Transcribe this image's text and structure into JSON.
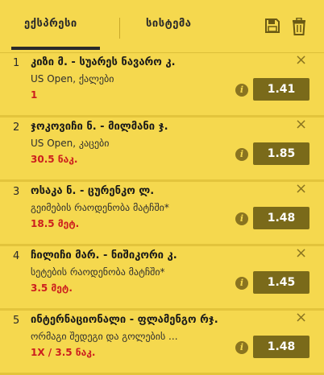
{
  "tabs": {
    "express": "ექსპრესი",
    "system": "სისტემა"
  },
  "icons": {
    "save": "save-icon",
    "trash": "trash-icon",
    "close": "close-icon",
    "info": "info-icon"
  },
  "colors": {
    "background": "#f5d84e",
    "odds_box": "#7a6a1a",
    "pick_red": "#cc1e1e"
  },
  "bets": [
    {
      "num": "1",
      "title": "კიზი მ. - სუარეს ნავარო კ.",
      "market": "US Open, ქალები",
      "pick": "1",
      "odds": "1.41",
      "close": "×",
      "info": "i"
    },
    {
      "num": "2",
      "title": "ჯოკოვიჩი ნ. - მილმანი ჯ.",
      "market": "US Open, კაცები",
      "pick": "30.5 ნაკ.",
      "odds": "1.85",
      "close": "×",
      "info": "i"
    },
    {
      "num": "3",
      "title": "ოსაკა ნ. - ცურენკო ლ.",
      "market": "გეიმების რაოდენობა მატჩში*",
      "pick": "18.5 მეტ.",
      "odds": "1.48",
      "close": "×",
      "info": "i"
    },
    {
      "num": "4",
      "title": "ჩილიჩი მარ. - ნიშიკორი კ.",
      "market": "სეტების რაოდენობა მატჩში*",
      "pick": "3.5 მეტ.",
      "odds": "1.45",
      "close": "×",
      "info": "i"
    },
    {
      "num": "5",
      "title": "ინტერნაციონალი - ფლამენგო რჯ.",
      "market": "ორმაგი შედეგი და გოლების ...",
      "pick": "1X / 3.5 ნაკ.",
      "odds": "1.48",
      "close": "×",
      "info": "i"
    }
  ]
}
